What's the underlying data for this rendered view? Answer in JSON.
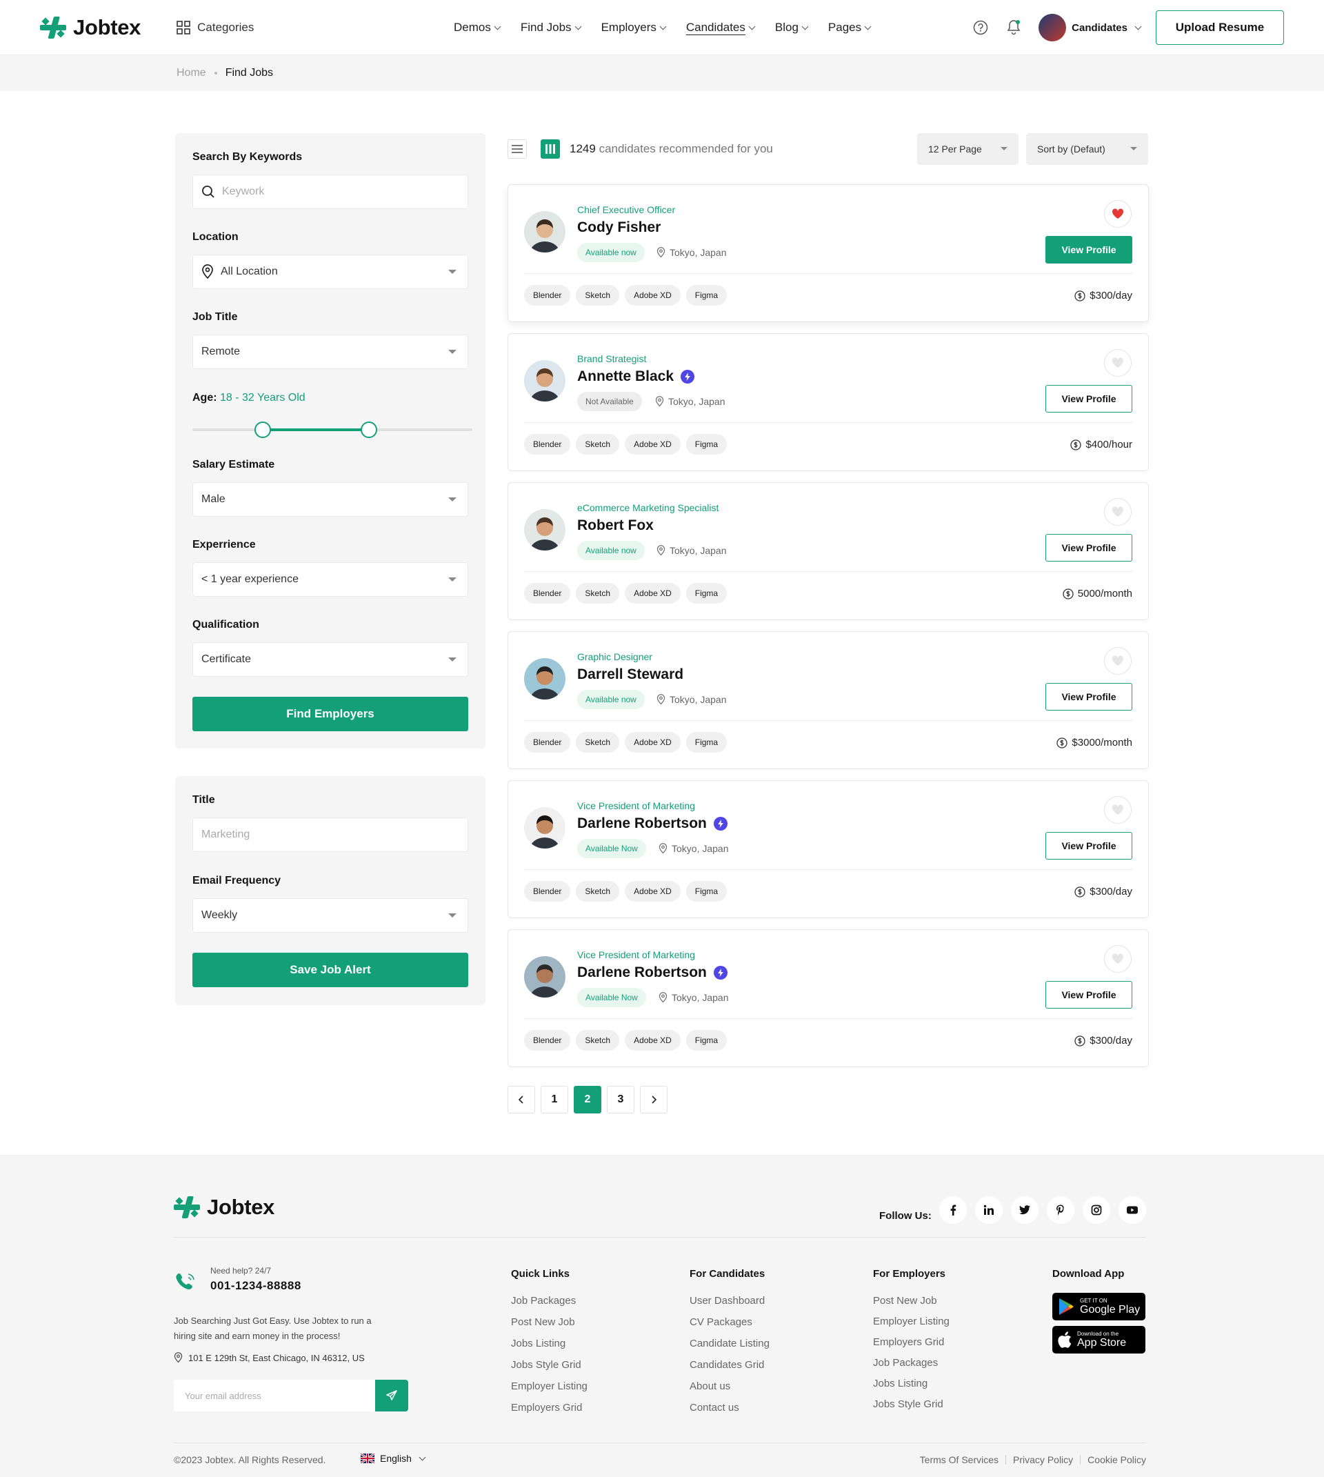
{
  "header": {
    "logo": "Jobtex",
    "categories": "Categories",
    "nav": [
      {
        "label": "Demos",
        "active": false
      },
      {
        "label": "Find Jobs",
        "active": false
      },
      {
        "label": "Employers",
        "active": false
      },
      {
        "label": "Candidates",
        "active": true
      },
      {
        "label": "Blog",
        "active": false
      },
      {
        "label": "Pages",
        "active": false
      }
    ],
    "user_label": "Candidates",
    "upload_button": "Upload Resume"
  },
  "breadcrumb": {
    "home": "Home",
    "current": "Find Jobs"
  },
  "filters": {
    "keyword_label": "Search By Keywords",
    "keyword_placeholder": "Keywork",
    "location_label": "Location",
    "location_value": "All Location",
    "job_title_label": "Job Title",
    "job_title_value": "Remote",
    "age_label": "Age:",
    "age_value": "18 - 32 Years Old",
    "age_range": {
      "min": 0.25,
      "max": 0.63
    },
    "salary_label": "Salary Estimate",
    "salary_value": "Male",
    "experience_label": "Experrience",
    "experience_value": "< 1 year experience",
    "qualification_label": "Qualification",
    "qualification_value": "Certificate",
    "find_button": "Find Employers"
  },
  "alert": {
    "title_label": "Title",
    "title_placeholder": "Marketing",
    "frequency_label": "Email Frequency",
    "frequency_value": "Weekly",
    "save_button": "Save Job Alert"
  },
  "results": {
    "count": "1249",
    "count_text": "candidates recommended for you",
    "per_page": "12 Per Page",
    "sort": "Sort by (Defaut)"
  },
  "candidates": [
    {
      "role": "Chief Executive Officer",
      "name": "Cody Fisher",
      "verified": false,
      "status": "Available now",
      "available": true,
      "location": "Tokyo, Japan",
      "tags": [
        "Blender",
        "Sketch",
        "Adobe XD",
        "Figma"
      ],
      "rate": "$300/day",
      "favorite": true,
      "button": "View Profile"
    },
    {
      "role": "Brand Strategist",
      "name": "Annette Black",
      "verified": true,
      "status": "Not Available",
      "available": false,
      "location": "Tokyo, Japan",
      "tags": [
        "Blender",
        "Sketch",
        "Adobe XD",
        "Figma"
      ],
      "rate": "$400/hour",
      "favorite": false,
      "button": "View Profile"
    },
    {
      "role": "eCommerce Marketing Specialist",
      "name": "Robert Fox",
      "verified": false,
      "status": "Available now",
      "available": true,
      "location": "Tokyo, Japan",
      "tags": [
        "Blender",
        "Sketch",
        "Adobe XD",
        "Figma"
      ],
      "rate": "5000/month",
      "favorite": false,
      "button": "View Profile"
    },
    {
      "role": "Graphic Designer",
      "name": "Darrell Steward",
      "verified": false,
      "status": "Available now",
      "available": true,
      "location": "Tokyo, Japan",
      "tags": [
        "Blender",
        "Sketch",
        "Adobe XD",
        "Figma"
      ],
      "rate": "$3000/month",
      "favorite": false,
      "button": "View Profile"
    },
    {
      "role": "Vice President of Marketing",
      "name": "Darlene Robertson",
      "verified": true,
      "status": "Available Now",
      "available": true,
      "location": "Tokyo, Japan",
      "tags": [
        "Blender",
        "Sketch",
        "Adobe XD",
        "Figma"
      ],
      "rate": "$300/day",
      "favorite": false,
      "button": "View Profile"
    },
    {
      "role": "Vice President of Marketing",
      "name": "Darlene Robertson",
      "verified": true,
      "status": "Available Now",
      "available": true,
      "location": "Tokyo, Japan",
      "tags": [
        "Blender",
        "Sketch",
        "Adobe XD",
        "Figma"
      ],
      "rate": "$300/day",
      "favorite": false,
      "button": "View Profile"
    }
  ],
  "pagination": {
    "pages": [
      "1",
      "2",
      "3"
    ],
    "current": "2"
  },
  "footer": {
    "logo": "Jobtex",
    "follow": "Follow Us:",
    "social_icons": [
      "facebook-icon",
      "linkedin-icon",
      "twitter-icon",
      "pinterest-icon",
      "instagram-icon",
      "youtube-icon"
    ],
    "help_label": "Need help? 24/7",
    "phone": "001-1234-88888",
    "blurb_1": "Job Searching Just Got Easy. Use Jobtex to run a",
    "blurb_2": "hiring site and earn money in the process!",
    "address": "101 E 129th St, East Chicago, IN 46312, US",
    "email_placeholder": "Your email address",
    "columns": [
      {
        "title": "Quick Links",
        "items": [
          "Job Packages",
          "Post New Job",
          "Jobs Listing",
          "Jobs Style Grid",
          "Employer Listing",
          "Employers Grid"
        ]
      },
      {
        "title": "For Candidates",
        "items": [
          "User Dashboard",
          "CV Packages",
          "Candidate Listing",
          "Candidates Grid",
          "About us",
          "Contact us"
        ]
      },
      {
        "title": "For Employers",
        "items": [
          "Post New Job",
          "Employer Listing",
          "Employers Grid",
          "Job Packages",
          "Jobs Listing",
          "Jobs Style Grid"
        ]
      }
    ],
    "download_title": "Download App",
    "google_small": "GET IT ON",
    "google_big": "Google Play",
    "apple_small": "Download on the",
    "apple_big": "App Store",
    "copyright": "©2023 Jobtex. All Rights Reserved.",
    "language": "English",
    "legal": [
      "Terms Of Services",
      "Privacy Policy",
      "Cookie Policy"
    ]
  },
  "colors": {
    "accent": "#14a077",
    "verified": "#4f46e5",
    "heart": "#e53935"
  }
}
